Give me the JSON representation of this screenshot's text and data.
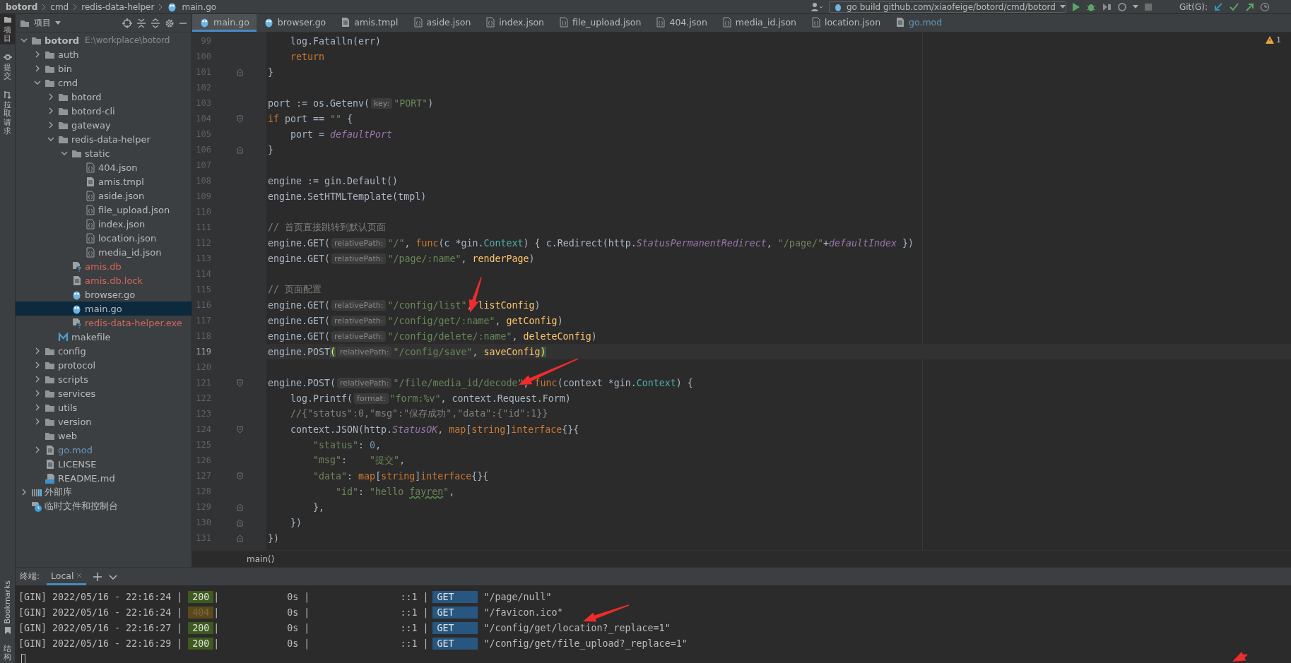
{
  "breadcrumb": [
    "botord",
    "cmd",
    "redis-data-helper",
    "main.go"
  ],
  "toolbar": {
    "run_config": "go build github.com/xiaofeige/botord/cmd/botord",
    "git_label": "Git(G):"
  },
  "tool_strip": {
    "top": [
      {
        "label": "项目",
        "selected": true
      },
      {
        "label": "提交",
        "selected": false
      },
      {
        "label": "拉取请求",
        "selected": false
      }
    ],
    "bottom": [
      {
        "label": "Bookmarks",
        "kind": "latin"
      },
      {
        "label": "结构",
        "kind": "cjk"
      }
    ]
  },
  "project_panel": {
    "title": "项目",
    "tree": [
      {
        "label": "botord",
        "path": "E:\\workplace\\botord",
        "kind": "folder",
        "expanded": true,
        "selected": false,
        "color": "#bbbbbb",
        "children": [
          {
            "label": "auth",
            "kind": "folder",
            "expanded": false,
            "selected": false,
            "color": "#bbbbbb"
          },
          {
            "label": "bin",
            "kind": "folder",
            "expanded": false,
            "selected": false,
            "color": "#bbbbbb"
          },
          {
            "label": "cmd",
            "kind": "folder",
            "expanded": true,
            "selected": false,
            "color": "#bbbbbb",
            "children": [
              {
                "label": "botord",
                "kind": "folder",
                "expanded": false,
                "selected": false,
                "color": "#bbbbbb"
              },
              {
                "label": "botord-cli",
                "kind": "folder",
                "expanded": false,
                "selected": false,
                "color": "#bbbbbb"
              },
              {
                "label": "gateway",
                "kind": "folder",
                "expanded": false,
                "selected": false,
                "color": "#bbbbbb"
              },
              {
                "label": "redis-data-helper",
                "kind": "folder",
                "expanded": true,
                "selected": false,
                "color": "#bbbbbb",
                "children": [
                  {
                    "label": "static",
                    "kind": "folder",
                    "expanded": true,
                    "selected": false,
                    "color": "#bbbbbb",
                    "children": [
                      {
                        "label": "404.json",
                        "kind": "json",
                        "selected": false,
                        "color": "#bbbbbb"
                      },
                      {
                        "label": "amis.tmpl",
                        "kind": "text",
                        "selected": false,
                        "color": "#bbbbbb"
                      },
                      {
                        "label": "aside.json",
                        "kind": "json",
                        "selected": false,
                        "color": "#bbbbbb"
                      },
                      {
                        "label": "file_upload.json",
                        "kind": "json",
                        "selected": false,
                        "color": "#bbbbbb"
                      },
                      {
                        "label": "index.json",
                        "kind": "json",
                        "selected": false,
                        "color": "#bbbbbb"
                      },
                      {
                        "label": "location.json",
                        "kind": "json",
                        "selected": false,
                        "color": "#bbbbbb"
                      },
                      {
                        "label": "media_id.json",
                        "kind": "json",
                        "selected": false,
                        "color": "#bbbbbb"
                      }
                    ]
                  },
                  {
                    "label": "amis.db",
                    "kind": "unknown",
                    "selected": false,
                    "color": "#d1675a"
                  },
                  {
                    "label": "amis.db.lock",
                    "kind": "text",
                    "selected": false,
                    "color": "#d1675a"
                  },
                  {
                    "label": "browser.go",
                    "kind": "go",
                    "selected": false,
                    "color": "#bbbbbb"
                  },
                  {
                    "label": "main.go",
                    "kind": "go",
                    "selected": true,
                    "color": "#bbbbbb"
                  },
                  {
                    "label": "redis-data-helper.exe",
                    "kind": "unknown",
                    "selected": false,
                    "color": "#d1675a"
                  }
                ]
              },
              {
                "label": "makefile",
                "kind": "make",
                "selected": false,
                "color": "#bbbbbb"
              }
            ]
          },
          {
            "label": "config",
            "kind": "folder",
            "expanded": false,
            "selected": false,
            "color": "#bbbbbb"
          },
          {
            "label": "protocol",
            "kind": "folder",
            "expanded": false,
            "selected": false,
            "color": "#bbbbbb"
          },
          {
            "label": "scripts",
            "kind": "folder",
            "expanded": false,
            "selected": false,
            "color": "#bbbbbb"
          },
          {
            "label": "services",
            "kind": "folder",
            "expanded": false,
            "selected": false,
            "color": "#bbbbbb"
          },
          {
            "label": "utils",
            "kind": "folder",
            "expanded": false,
            "selected": false,
            "color": "#bbbbbb"
          },
          {
            "label": "version",
            "kind": "folder",
            "expanded": false,
            "selected": false,
            "color": "#bbbbbb"
          },
          {
            "label": "web",
            "kind": "empty-folder",
            "selected": false,
            "color": "#bbbbbb"
          },
          {
            "label": "go.mod",
            "kind": "text",
            "expanded": false,
            "selected": false,
            "color": "#6897bb"
          },
          {
            "label": "LICENSE",
            "kind": "text",
            "selected": false,
            "color": "#bbbbbb"
          },
          {
            "label": "README.md",
            "kind": "markdown",
            "selected": false,
            "color": "#bbbbbb"
          }
        ]
      },
      {
        "label": "外部库",
        "kind": "library",
        "expanded": false,
        "selected": false,
        "color": "#bbbbbb"
      },
      {
        "label": "临时文件和控制台",
        "kind": "scratch",
        "selected": false,
        "color": "#bbbbbb"
      }
    ]
  },
  "editor": {
    "tabs": [
      {
        "label": "main.go",
        "kind": "go",
        "selected": true,
        "color": "#bbbbbb"
      },
      {
        "label": "browser.go",
        "kind": "go",
        "selected": false,
        "color": "#bbbbbb"
      },
      {
        "label": "amis.tmpl",
        "kind": "text",
        "selected": false,
        "color": "#bbbbbb"
      },
      {
        "label": "aside.json",
        "kind": "json",
        "selected": false,
        "color": "#bbbbbb"
      },
      {
        "label": "index.json",
        "kind": "json",
        "selected": false,
        "color": "#bbbbbb"
      },
      {
        "label": "file_upload.json",
        "kind": "json",
        "selected": false,
        "color": "#bbbbbb"
      },
      {
        "label": "404.json",
        "kind": "json",
        "selected": false,
        "color": "#bbbbbb"
      },
      {
        "label": "media_id.json",
        "kind": "json",
        "selected": false,
        "color": "#bbbbbb"
      },
      {
        "label": "location.json",
        "kind": "json",
        "selected": false,
        "color": "#bbbbbb"
      },
      {
        "label": "go.mod",
        "kind": "text",
        "selected": false,
        "color": "#6897bb"
      }
    ],
    "warning_count": "1",
    "lines": [
      {
        "number": "99",
        "kind": "plain",
        "current": false,
        "tokens": [
          {
            "kind": "plain",
            "text": "    log.Fatalln(err)"
          }
        ]
      },
      {
        "number": "100",
        "kind": "plain",
        "current": false,
        "tokens": [
          {
            "kind": "keyword",
            "text": "    return"
          }
        ]
      },
      {
        "number": "101",
        "kind": "fold-end",
        "current": false,
        "tokens": [
          {
            "kind": "plain",
            "text": "}"
          }
        ]
      },
      {
        "number": "102",
        "kind": "plain",
        "current": false
      },
      {
        "number": "103",
        "kind": "plain",
        "current": false,
        "tokens": [
          {
            "kind": "plain",
            "text": "port := os.Getenv("
          },
          {
            "kind": "hint",
            "text": "key:"
          },
          {
            "kind": "string",
            "text": "\"PORT\""
          },
          {
            "kind": "plain",
            "text": ")"
          }
        ]
      },
      {
        "number": "104",
        "kind": "fold-start",
        "current": false,
        "tokens": [
          {
            "kind": "keyword",
            "text": "if"
          },
          {
            "kind": "plain",
            "text": " port == "
          },
          {
            "kind": "string",
            "text": "\"\""
          },
          {
            "kind": "plain",
            "text": " {"
          }
        ]
      },
      {
        "number": "105",
        "kind": "plain",
        "current": false,
        "tokens": [
          {
            "kind": "plain",
            "text": "    port = "
          },
          {
            "kind": "constant",
            "text": "defaultPort"
          }
        ]
      },
      {
        "number": "106",
        "kind": "fold-end",
        "current": false,
        "tokens": [
          {
            "kind": "plain",
            "text": "}"
          }
        ]
      },
      {
        "number": "107",
        "kind": "plain",
        "current": false
      },
      {
        "number": "108",
        "kind": "plain",
        "current": false,
        "tokens": [
          {
            "kind": "plain",
            "text": "engine := gin.Default()"
          }
        ]
      },
      {
        "number": "109",
        "kind": "plain",
        "current": false,
        "tokens": [
          {
            "kind": "plain",
            "text": "engine.SetHTMLTemplate(tmpl)"
          }
        ]
      },
      {
        "number": "110",
        "kind": "plain",
        "current": false
      },
      {
        "number": "111",
        "kind": "plain",
        "current": false,
        "tokens": [
          {
            "kind": "comment",
            "text": "// 首页直接跳转到默认页面"
          }
        ]
      },
      {
        "number": "112",
        "kind": "plain",
        "current": false,
        "tokens": [
          {
            "kind": "plain",
            "text": "engine.GET("
          },
          {
            "kind": "hint",
            "text": "relativePath:"
          },
          {
            "kind": "string",
            "text": "\"/\""
          },
          {
            "kind": "plain",
            "text": ", "
          },
          {
            "kind": "keyword",
            "text": "func"
          },
          {
            "kind": "plain",
            "text": "(c *gin."
          },
          {
            "kind": "type",
            "text": "Context"
          },
          {
            "kind": "plain",
            "text": ") { c.Redirect(http."
          },
          {
            "kind": "constant",
            "text": "StatusPermanentRedirect"
          },
          {
            "kind": "plain",
            "text": ", "
          },
          {
            "kind": "string",
            "text": "\"/page/\""
          },
          {
            "kind": "plain",
            "text": "+"
          },
          {
            "kind": "constant",
            "text": "defaultIndex"
          },
          {
            "kind": "plain",
            "text": " })"
          }
        ]
      },
      {
        "number": "113",
        "kind": "plain",
        "current": false,
        "tokens": [
          {
            "kind": "plain",
            "text": "engine.GET("
          },
          {
            "kind": "hint",
            "text": "relativePath:"
          },
          {
            "kind": "string",
            "text": "\"/page/:name\""
          },
          {
            "kind": "plain",
            "text": ", "
          },
          {
            "kind": "function",
            "text": "renderPage"
          },
          {
            "kind": "plain",
            "text": ")"
          }
        ]
      },
      {
        "number": "114",
        "kind": "plain",
        "current": false
      },
      {
        "number": "115",
        "kind": "plain",
        "current": false,
        "tokens": [
          {
            "kind": "comment",
            "text": "// 页面配置"
          }
        ]
      },
      {
        "number": "116",
        "kind": "plain",
        "current": false,
        "tokens": [
          {
            "kind": "plain",
            "text": "engine.GET("
          },
          {
            "kind": "hint",
            "text": "relativePath:"
          },
          {
            "kind": "string",
            "text": "\"/config/list\""
          },
          {
            "kind": "plain",
            "text": ", "
          },
          {
            "kind": "function",
            "text": "listConfig"
          },
          {
            "kind": "plain",
            "text": ")"
          }
        ]
      },
      {
        "number": "117",
        "kind": "plain",
        "current": false,
        "tokens": [
          {
            "kind": "plain",
            "text": "engine.GET("
          },
          {
            "kind": "hint",
            "text": "relativePath:"
          },
          {
            "kind": "string",
            "text": "\"/config/get/:name\""
          },
          {
            "kind": "plain",
            "text": ", "
          },
          {
            "kind": "function",
            "text": "getConfig"
          },
          {
            "kind": "plain",
            "text": ")"
          }
        ]
      },
      {
        "number": "118",
        "kind": "plain",
        "current": false,
        "tokens": [
          {
            "kind": "plain",
            "text": "engine.GET("
          },
          {
            "kind": "hint",
            "text": "relativePath:"
          },
          {
            "kind": "string",
            "text": "\"/config/delete/:name\""
          },
          {
            "kind": "plain",
            "text": ", "
          },
          {
            "kind": "function",
            "text": "deleteConfig"
          },
          {
            "kind": "plain",
            "text": ")"
          }
        ]
      },
      {
        "number": "119",
        "kind": "plain",
        "current": true,
        "tokens": [
          {
            "kind": "plain",
            "text": "engine.POST"
          },
          {
            "kind": "bracket",
            "text": "("
          },
          {
            "kind": "hint",
            "text": "relativePath:"
          },
          {
            "kind": "string",
            "text": "\"/config/save\""
          },
          {
            "kind": "plain",
            "text": ", "
          },
          {
            "kind": "function",
            "text": "saveConfig"
          },
          {
            "kind": "bracket",
            "text": ")"
          }
        ]
      },
      {
        "number": "120",
        "kind": "plain",
        "current": false
      },
      {
        "number": "121",
        "kind": "fold-start",
        "current": false,
        "tokens": [
          {
            "kind": "plain",
            "text": "engine.POST("
          },
          {
            "kind": "hint",
            "text": "relativePath:"
          },
          {
            "kind": "string",
            "text": "\"/file/media_id/decode\""
          },
          {
            "kind": "plain",
            "text": ", "
          },
          {
            "kind": "keyword",
            "text": "func"
          },
          {
            "kind": "plain",
            "text": "(context *gin."
          },
          {
            "kind": "type",
            "text": "Context"
          },
          {
            "kind": "plain",
            "text": ") {"
          }
        ]
      },
      {
        "number": "122",
        "kind": "plain",
        "current": false,
        "tokens": [
          {
            "kind": "plain",
            "text": "    log.Printf("
          },
          {
            "kind": "hint",
            "text": "format:"
          },
          {
            "kind": "string",
            "text": "\"form:%v\""
          },
          {
            "kind": "plain",
            "text": ", context.Request.Form)"
          }
        ]
      },
      {
        "number": "123",
        "kind": "plain",
        "current": false,
        "tokens": [
          {
            "kind": "comment",
            "text": "    //{\"status\":0,\"msg\":\"保存成功\",\"data\":{\"id\":1}}"
          }
        ]
      },
      {
        "number": "124",
        "kind": "fold-start",
        "current": false,
        "tokens": [
          {
            "kind": "plain",
            "text": "    context.JSON(http."
          },
          {
            "kind": "constant",
            "text": "StatusOK"
          },
          {
            "kind": "plain",
            "text": ", "
          },
          {
            "kind": "keyword",
            "text": "map"
          },
          {
            "kind": "plain",
            "text": "["
          },
          {
            "kind": "keyword",
            "text": "string"
          },
          {
            "kind": "plain",
            "text": "]"
          },
          {
            "kind": "keyword",
            "text": "interface"
          },
          {
            "kind": "plain",
            "text": "{}{"
          }
        ]
      },
      {
        "number": "125",
        "kind": "plain",
        "current": false,
        "tokens": [
          {
            "kind": "string",
            "text": "        \"status\""
          },
          {
            "kind": "plain",
            "text": ": "
          },
          {
            "kind": "number",
            "text": "0"
          },
          {
            "kind": "plain",
            "text": ","
          }
        ]
      },
      {
        "number": "126",
        "kind": "plain",
        "current": false,
        "tokens": [
          {
            "kind": "string",
            "text": "        \"msg\""
          },
          {
            "kind": "plain",
            "text": ":    "
          },
          {
            "kind": "string",
            "text": "\"提交\""
          },
          {
            "kind": "plain",
            "text": ","
          }
        ]
      },
      {
        "number": "127",
        "kind": "fold-start",
        "current": false,
        "tokens": [
          {
            "kind": "string",
            "text": "        \"data\""
          },
          {
            "kind": "plain",
            "text": ": "
          },
          {
            "kind": "keyword",
            "text": "map"
          },
          {
            "kind": "plain",
            "text": "["
          },
          {
            "kind": "keyword",
            "text": "string"
          },
          {
            "kind": "plain",
            "text": "]"
          },
          {
            "kind": "keyword",
            "text": "interface"
          },
          {
            "kind": "plain",
            "text": "{}{"
          }
        ]
      },
      {
        "number": "128",
        "kind": "plain",
        "current": false,
        "tokens": [
          {
            "kind": "string",
            "text": "            \"id\""
          },
          {
            "kind": "plain",
            "text": ": "
          },
          {
            "kind": "string",
            "text": "\"hello "
          },
          {
            "kind": "typo",
            "text": "fayren"
          },
          {
            "kind": "string",
            "text": "\""
          },
          {
            "kind": "plain",
            "text": ","
          }
        ]
      },
      {
        "number": "129",
        "kind": "fold-end",
        "current": false,
        "tokens": [
          {
            "kind": "plain",
            "text": "        },"
          }
        ]
      },
      {
        "number": "130",
        "kind": "fold-end",
        "current": false,
        "tokens": [
          {
            "kind": "plain",
            "text": "    })"
          }
        ]
      },
      {
        "number": "131",
        "kind": "fold-end",
        "current": false,
        "tokens": [
          {
            "kind": "plain",
            "text": "})"
          }
        ]
      }
    ],
    "breadcrumb": "main()"
  },
  "terminal": {
    "title": "终端:",
    "tabs": [
      {
        "label": "Local",
        "selected": true
      }
    ],
    "rows": [
      {
        "head": "[GIN] 2022/05/16 - 22:16:24 |",
        "status": "200",
        "kind": "success",
        "middle": "|            0s |                ::1 |",
        "method": "GET",
        "path": "\"/page/null\""
      },
      {
        "head": "[GIN] 2022/05/16 - 22:16:24 |",
        "status": "404",
        "kind": "warning",
        "middle": "|            0s |                ::1 |",
        "method": "GET",
        "path": "\"/favicon.ico\""
      },
      {
        "head": "[GIN] 2022/05/16 - 22:16:27 |",
        "status": "200",
        "kind": "success",
        "middle": "|            0s |                ::1 |",
        "method": "GET",
        "path": "\"/config/get/location?_replace=1\""
      },
      {
        "head": "[GIN] 2022/05/16 - 22:16:29 |",
        "status": "200",
        "kind": "success",
        "middle": "|            0s |                ::1 |",
        "method": "GET",
        "path": "\"/config/get/file_upload?_replace=1\""
      }
    ]
  }
}
